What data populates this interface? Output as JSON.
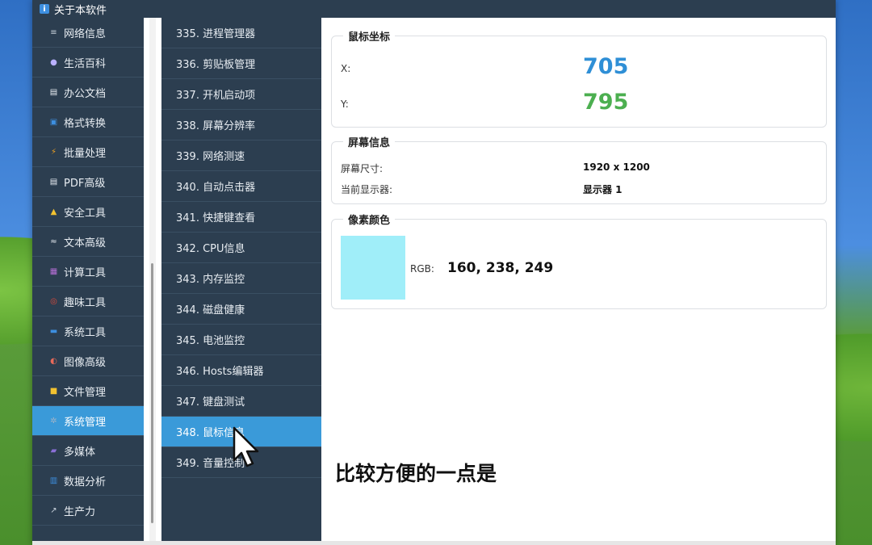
{
  "window": {
    "title": "关于本软件"
  },
  "sidebar": {
    "items": [
      {
        "label": "网络信息",
        "icon": "network-icon",
        "color": "#c9d3dd"
      },
      {
        "label": "生活百科",
        "icon": "planet-icon",
        "color": "#b9b0ff"
      },
      {
        "label": "办公文档",
        "icon": "document-icon",
        "color": "#e8edf2"
      },
      {
        "label": "格式转换",
        "icon": "convert-icon",
        "color": "#3d8fe0"
      },
      {
        "label": "批量处理",
        "icon": "lightning-icon",
        "color": "#f0a020"
      },
      {
        "label": "PDF高级",
        "icon": "pdf-icon",
        "color": "#e8edf2"
      },
      {
        "label": "安全工具",
        "icon": "lock-icon",
        "color": "#f2c230"
      },
      {
        "label": "文本高级",
        "icon": "text-icon",
        "color": "#e8edf2"
      },
      {
        "label": "计算工具",
        "icon": "calculator-icon",
        "color": "#b66fd6"
      },
      {
        "label": "趣味工具",
        "icon": "target-icon",
        "color": "#e04a3a"
      },
      {
        "label": "系统工具",
        "icon": "monitor-icon",
        "color": "#3d8fe0"
      },
      {
        "label": "图像高级",
        "icon": "palette-icon",
        "color": "#e86a5a"
      },
      {
        "label": "文件管理",
        "icon": "folder-icon",
        "color": "#f2c230"
      },
      {
        "label": "系统管理",
        "icon": "gear-icon",
        "color": "#9fb3c8",
        "active": true
      },
      {
        "label": "多媒体",
        "icon": "clapper-icon",
        "color": "#8a6fd6"
      },
      {
        "label": "数据分析",
        "icon": "chart-icon",
        "color": "#3d8fe0"
      },
      {
        "label": "生产力",
        "icon": "trend-icon",
        "color": "#c9d3dd"
      }
    ]
  },
  "tools": {
    "items": [
      {
        "label": "335. 进程管理器"
      },
      {
        "label": "336. 剪贴板管理"
      },
      {
        "label": "337. 开机启动项"
      },
      {
        "label": "338. 屏幕分辨率"
      },
      {
        "label": "339. 网络测速"
      },
      {
        "label": "340. 自动点击器"
      },
      {
        "label": "341. 快捷键查看"
      },
      {
        "label": "342. CPU信息"
      },
      {
        "label": "343. 内存监控"
      },
      {
        "label": "344. 磁盘健康"
      },
      {
        "label": "345. 电池监控"
      },
      {
        "label": "346. Hosts编辑器"
      },
      {
        "label": "347. 键盘测试"
      },
      {
        "label": "348. 鼠标信息",
        "active": true
      },
      {
        "label": "349. 音量控制"
      }
    ]
  },
  "mouse": {
    "title": "鼠标坐标",
    "x_label": "X:",
    "x_value": "705",
    "y_label": "Y:",
    "y_value": "795",
    "x_color": "#2f8fd6",
    "y_color": "#4caf50"
  },
  "screen": {
    "title": "屏幕信息",
    "size_label": "屏幕尺寸:",
    "size_value": "1920 x 1200",
    "display_label": "当前显示器:",
    "display_value": "显示器 1"
  },
  "pixel": {
    "title": "像素颜色",
    "rgb_label": "RGB:",
    "rgb_value": "160, 238, 249",
    "swatch_color": "#a0eef9"
  },
  "caption": "比较方便的一点是"
}
